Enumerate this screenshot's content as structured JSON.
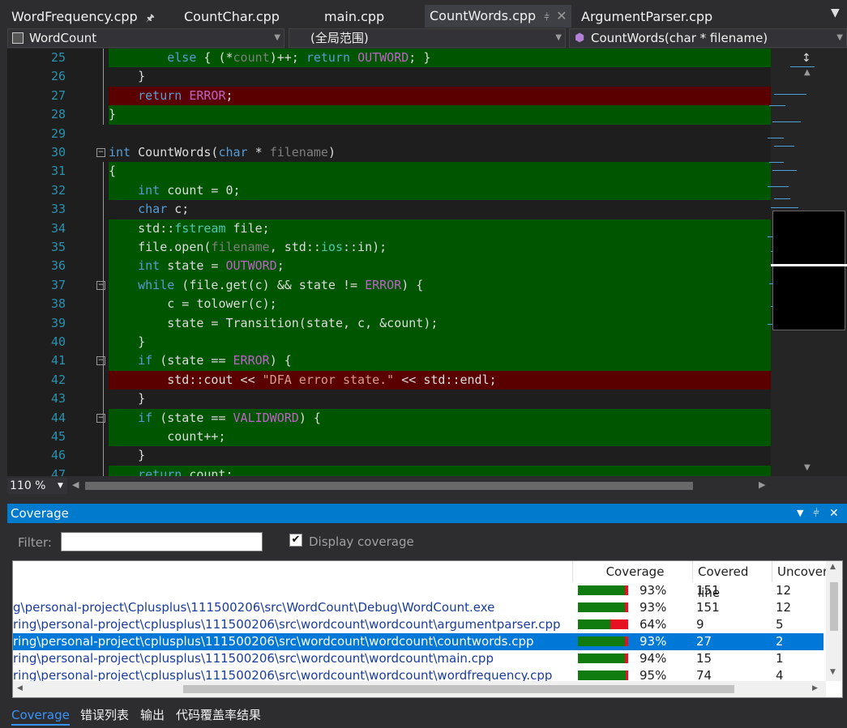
{
  "tabs": [
    {
      "label": "WordFrequency.cpp",
      "pinned": true
    },
    {
      "label": "CountChar.cpp"
    },
    {
      "label": "main.cpp"
    },
    {
      "label": "CountWords.cpp",
      "active": true,
      "pinned": true
    },
    {
      "label": "ArgumentParser.cpp"
    }
  ],
  "navbar": {
    "project": "WordCount",
    "scope": "(全局范围)",
    "member": "CountWords(char * filename)"
  },
  "colors": {
    "covered_bg": "#005500",
    "uncovered_bg": "#5a0000",
    "keyword": "#569cd6",
    "macro": "#bd63c5",
    "param": "#7f7f7f",
    "string": "#d69d85",
    "type": "#4ec9b0",
    "accent": "#007acc"
  },
  "code_lines": [
    {
      "n": "25",
      "status": "covered",
      "tokens": [
        [
          "        ",
          "p"
        ],
        [
          "else",
          "k"
        ],
        [
          " { (*",
          "p"
        ],
        [
          "count",
          "v"
        ],
        [
          ")++; ",
          "p"
        ],
        [
          "return",
          "k"
        ],
        [
          " ",
          "p"
        ],
        [
          "OUTWORD",
          "m"
        ],
        [
          "; }",
          "p"
        ]
      ]
    },
    {
      "n": "26",
      "status": "none",
      "tokens": [
        [
          "    }",
          "p"
        ]
      ]
    },
    {
      "n": "27",
      "status": "uncovered",
      "tokens": [
        [
          "    ",
          "p"
        ],
        [
          "return",
          "k"
        ],
        [
          " ",
          "p"
        ],
        [
          "ERROR",
          "m"
        ],
        [
          ";",
          "p"
        ]
      ]
    },
    {
      "n": "28",
      "status": "covered",
      "tokens": [
        [
          "}",
          "p"
        ]
      ]
    },
    {
      "n": "29",
      "status": "none",
      "tokens": []
    },
    {
      "n": "30",
      "status": "none",
      "fold": true,
      "tokens": [
        [
          "int",
          "k"
        ],
        [
          " CountWords(",
          "p"
        ],
        [
          "char",
          "k"
        ],
        [
          " * ",
          "p"
        ],
        [
          "filename",
          "v"
        ],
        [
          ")",
          "p"
        ]
      ]
    },
    {
      "n": "31",
      "status": "covered",
      "tokens": [
        [
          "{",
          "p"
        ]
      ]
    },
    {
      "n": "32",
      "status": "covered",
      "tokens": [
        [
          "    ",
          "p"
        ],
        [
          "int",
          "k"
        ],
        [
          " count = 0;",
          "p"
        ]
      ]
    },
    {
      "n": "33",
      "status": "none",
      "tokens": [
        [
          "    ",
          "p"
        ],
        [
          "char",
          "k"
        ],
        [
          " c;",
          "p"
        ]
      ]
    },
    {
      "n": "34",
      "status": "covered",
      "tokens": [
        [
          "    std::",
          "p"
        ],
        [
          "fstream",
          "t"
        ],
        [
          " file;",
          "p"
        ]
      ]
    },
    {
      "n": "35",
      "status": "covered",
      "tokens": [
        [
          "    file.open(",
          "p"
        ],
        [
          "filename",
          "v"
        ],
        [
          ", std::",
          "p"
        ],
        [
          "ios",
          "t"
        ],
        [
          "::in);",
          "p"
        ]
      ]
    },
    {
      "n": "36",
      "status": "covered",
      "tokens": [
        [
          "    ",
          "p"
        ],
        [
          "int",
          "k"
        ],
        [
          " state = ",
          "p"
        ],
        [
          "OUTWORD",
          "m"
        ],
        [
          ";",
          "p"
        ]
      ]
    },
    {
      "n": "37",
      "status": "covered",
      "fold": true,
      "tokens": [
        [
          "    ",
          "p"
        ],
        [
          "while",
          "k"
        ],
        [
          " (file.get(c) && state != ",
          "p"
        ],
        [
          "ERROR",
          "m"
        ],
        [
          ") {",
          "p"
        ]
      ]
    },
    {
      "n": "38",
      "status": "covered",
      "tokens": [
        [
          "        c = tolower(c);",
          "p"
        ]
      ]
    },
    {
      "n": "39",
      "status": "covered",
      "tokens": [
        [
          "        state = Transition(state, c, &count);",
          "p"
        ]
      ]
    },
    {
      "n": "40",
      "status": "covered",
      "tokens": [
        [
          "    }",
          "p"
        ]
      ]
    },
    {
      "n": "41",
      "status": "covered",
      "fold": true,
      "tokens": [
        [
          "    ",
          "p"
        ],
        [
          "if",
          "k"
        ],
        [
          " (state == ",
          "p"
        ],
        [
          "ERROR",
          "m"
        ],
        [
          ") {",
          "p"
        ]
      ]
    },
    {
      "n": "42",
      "status": "uncovered",
      "tokens": [
        [
          "        std::cout << ",
          "p"
        ],
        [
          "\"DFA error state.\"",
          "s"
        ],
        [
          " << std::endl;",
          "p"
        ]
      ]
    },
    {
      "n": "43",
      "status": "none",
      "tokens": [
        [
          "    }",
          "p"
        ]
      ]
    },
    {
      "n": "44",
      "status": "covered",
      "fold": true,
      "tokens": [
        [
          "    ",
          "p"
        ],
        [
          "if",
          "k"
        ],
        [
          " (state == ",
          "p"
        ],
        [
          "VALIDWORD",
          "m"
        ],
        [
          ") {",
          "p"
        ]
      ]
    },
    {
      "n": "45",
      "status": "covered",
      "tokens": [
        [
          "        count++;",
          "p"
        ]
      ]
    },
    {
      "n": "46",
      "status": "none",
      "tokens": [
        [
          "    }",
          "p"
        ]
      ]
    },
    {
      "n": "47",
      "status": "covered",
      "tokens": [
        [
          "    ",
          "p"
        ],
        [
          "return",
          "k"
        ],
        [
          " count;",
          "p"
        ]
      ]
    }
  ],
  "zoom": "110 %",
  "coverage_panel": {
    "title": "Coverage",
    "filter_label": "Filter:",
    "filter_value": "",
    "display_coverage_label": "Display coverage",
    "display_coverage_checked": true,
    "columns": [
      "Coverage",
      "Covered line",
      "Uncover"
    ],
    "rows": [
      {
        "name": "",
        "coverage_pct": 93,
        "coverage": "93%",
        "covered": "151",
        "uncovered": "12"
      },
      {
        "name": "g\\personal-project\\Cplusplus\\111500206\\src\\WordCount\\Debug\\WordCount.exe",
        "coverage_pct": 93,
        "coverage": "93%",
        "covered": "151",
        "uncovered": "12"
      },
      {
        "name": "ring\\personal-project\\cplusplus\\111500206\\src\\wordcount\\wordcount\\argumentparser.cpp",
        "coverage_pct": 64,
        "coverage": "64%",
        "covered": "9",
        "uncovered": "5"
      },
      {
        "name": "ring\\personal-project\\cplusplus\\111500206\\src\\wordcount\\wordcount\\countwords.cpp",
        "coverage_pct": 93,
        "coverage": "93%",
        "covered": "27",
        "uncovered": "2",
        "selected": true
      },
      {
        "name": "ring\\personal-project\\cplusplus\\111500206\\src\\wordcount\\wordcount\\main.cpp",
        "coverage_pct": 94,
        "coverage": "94%",
        "covered": "15",
        "uncovered": "1"
      },
      {
        "name": "ring\\personal-project\\cplusplus\\111500206\\src\\wordcount\\wordcount\\wordfrequency.cpp",
        "coverage_pct": 95,
        "coverage": "95%",
        "covered": "74",
        "uncovered": "4"
      }
    ]
  },
  "bottom_tabs": [
    {
      "label": "Coverage",
      "active": true
    },
    {
      "label": "错误列表"
    },
    {
      "label": "输出"
    },
    {
      "label": "代码覆盖率结果"
    }
  ]
}
